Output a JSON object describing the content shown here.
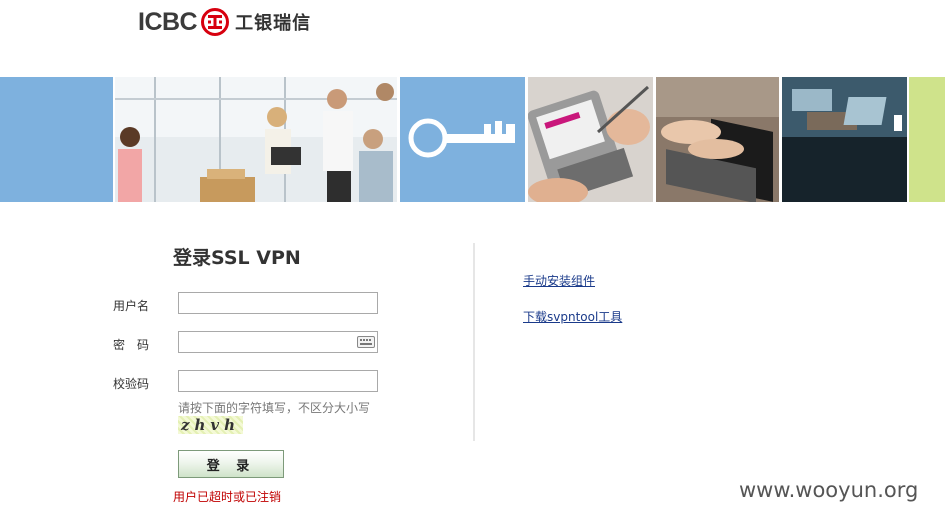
{
  "header": {
    "logo_text": "ICBC",
    "logo_mark_char": "工",
    "brand_cn": "工银瑞信"
  },
  "banner": {
    "panels": [
      {
        "name": "blue-panel"
      },
      {
        "name": "office-people-photo"
      },
      {
        "name": "key-panel",
        "icon": "key-icon"
      },
      {
        "name": "pda-stylus-photo"
      },
      {
        "name": "laptop-typing-photo"
      },
      {
        "name": "desk-laptop-photo"
      },
      {
        "name": "green-panel"
      }
    ],
    "colors": {
      "blue": "#7eb1de",
      "green": "#cfe38b"
    }
  },
  "login": {
    "title": "登录SSL VPN",
    "username_label": "用户名",
    "username_value": "",
    "password_label": "密　码",
    "password_value": "",
    "keyboard_icon": "keyboard-icon",
    "captcha_label": "校验码",
    "captcha_value": "",
    "captcha_hint": "请按下面的字符填写，不区分大小写",
    "captcha_text": "zhvh",
    "submit_label": "登 录",
    "error_text": "用户已超时或已注销",
    "error_color": "#c00000"
  },
  "links": {
    "manual_install": "手动安装组件",
    "download_tool": "下载svpntool工具"
  },
  "watermark": "www.wooyun.org"
}
